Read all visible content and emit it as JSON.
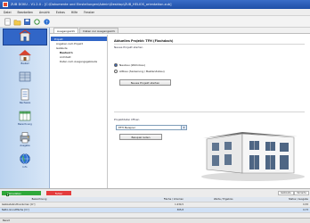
{
  "window": {
    "title": "ZUB DOKU - V1.2.0 - [C:\\Dokumente und Einstellungen\\Admin\\Desktop\\ZUB_HELIOS_orientation.zub]"
  },
  "menu": [
    "Datei",
    "Bearbeiten",
    "Ansicht",
    "Extras",
    "Hilfe",
    "Fenster"
  ],
  "toolbar": {
    "icons": [
      "new-doc-icon",
      "open-folder-icon",
      "save-icon",
      "refresh-icon",
      "help-icon"
    ]
  },
  "leftbar": {
    "items": [
      {
        "label": "",
        "icon": "building-icon"
      },
      {
        "label": "Bauteil",
        "icon": "house-icon"
      },
      {
        "label": "",
        "icon": "wall-icon"
      },
      {
        "label": "Nachweis",
        "icon": "form-icon"
      },
      {
        "label": "Berechnung",
        "icon": "table-icon"
      },
      {
        "label": "Ausgabe",
        "icon": "printer-icon"
      },
      {
        "label": "Info",
        "icon": "globe-icon"
      }
    ]
  },
  "tabs": [
    "Ausgangsinfo",
    "Daten zur Ausgangsinfo"
  ],
  "tree": [
    {
      "label": "Projekt",
      "sel": true
    },
    {
      "label": "Angaben zum Projekt",
      "level": 1
    },
    {
      "label": "Gebäude",
      "level": 1
    },
    {
      "label": "Bauherrn",
      "level": 2,
      "bold": true
    },
    {
      "label": "Architekt",
      "level": 2
    },
    {
      "label": "Daten zum Ausgangsgebäude",
      "level": 2
    }
  ],
  "content": {
    "title": "Aktuelles Projekt: TFH (Flachdach)",
    "subtitle": "Neues Projekt starten",
    "radio1": "Neubau (Wohnbau)",
    "radio2": "Altbau (Sanierung / Bestandsbau)",
    "new_project_button": "Neues Projekt starten",
    "choose_label": "Projektdatei öffnen",
    "select_value": "EFH Beispiel",
    "load_button": "Beispiel laden"
  },
  "bottom": {
    "green_tab": "Klimadaten",
    "red_tab": "Fehler",
    "right_tab1": "Gebäude",
    "right_tab2": "Variante",
    "columns": [
      "Bezeichnung",
      "",
      "Fläche / Volumen",
      "",
      "Werte / Ergebnis",
      "",
      "Status / Ausgabe"
    ],
    "rows": [
      [
        "Gebäudebruttovolumen [m³]",
        "",
        "1.234,5",
        "",
        "",
        "",
        "0,53"
      ],
      [
        "Netto-Grundfläche [m²]",
        "",
        "305,8",
        "",
        "",
        "",
        "0,73"
      ]
    ]
  },
  "status": {
    "text": "Bereit"
  }
}
